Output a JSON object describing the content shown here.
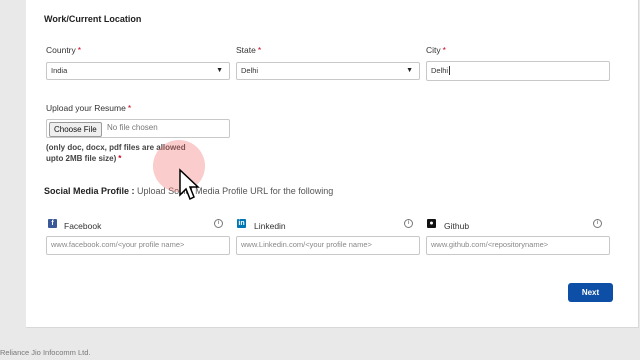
{
  "section": {
    "title": "Work/Current Location"
  },
  "location": {
    "country_label": "Country",
    "country_value": "India",
    "state_label": "State",
    "state_value": "Delhi",
    "city_label": "City",
    "city_value": "Delhi"
  },
  "resume": {
    "label": "Upload your Resume",
    "choose_button": "Choose File",
    "file_status": "No file chosen",
    "note_line1": "(only doc, docx, pdf files are allowed",
    "note_line2": "upto 2MB file size)"
  },
  "social": {
    "title": "Social Media Profile :",
    "subtitle": "Upload Social Media Profile URL for the following",
    "facebook_label": "Facebook",
    "facebook_placeholder": "www.facebook.com/<your profile name>",
    "linkedin_label": "Linkedin",
    "linkedin_placeholder": "www.Linkedin.com/<your profile name>",
    "github_label": "Github",
    "github_placeholder": "www.github.com/<repositoryname>"
  },
  "actions": {
    "next_label": "Next"
  },
  "footer": {
    "text": "Reliance Jio Infocomm Ltd."
  },
  "colors": {
    "accent": "#0d4ea6",
    "required": "#d0021b",
    "facebook": "#3b5998",
    "linkedin": "#0077b5",
    "github": "#111111"
  },
  "icons": {
    "select_arrow": "chevron-down-icon",
    "info": "info-icon"
  }
}
